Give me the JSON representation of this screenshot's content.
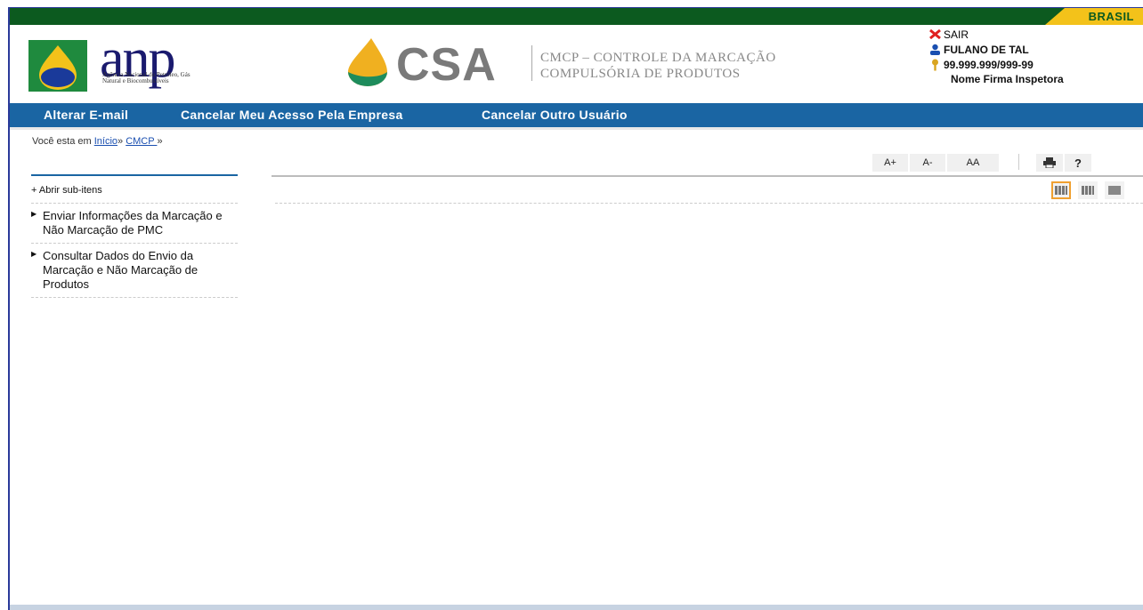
{
  "gov_bar": {
    "brasil_label": "BRASIL"
  },
  "header": {
    "anp_logo_text": "anp",
    "anp_subtitle": "Agência Nacional do Petróleo, Gás Natural e Biocombustíveis",
    "csa_logo_text": "CSA",
    "csa_desc_line1": "CMCP – CONTROLE DA MARCAÇÃO",
    "csa_desc_line2": "COMPULSÓRIA DE PRODUTOS"
  },
  "user": {
    "sair_label": "SAIR",
    "name": "FULANO DE TAL",
    "cnpj": "99.999.999/999-99",
    "firma": "Nome Firma Inspetora"
  },
  "nav": {
    "items": [
      "Alterar E-mail",
      "Cancelar Meu Acesso Pela Empresa",
      "Cancelar Outro Usuário"
    ]
  },
  "breadcrumb": {
    "prefix": "Você esta em",
    "links": [
      "Início",
      "CMCP "
    ],
    "sep": "»"
  },
  "tools": {
    "font_increase": "A+",
    "font_decrease": "A-",
    "font_default": "AA",
    "print_icon": "printer-icon",
    "help": "?"
  },
  "menu": {
    "expand_label": "+ Abrir sub-itens",
    "items": [
      "Enviar Informações da Marcação e Não Marcação de PMC",
      "Consultar Dados do Envio da Marcação e Não Marcação de Produtos"
    ]
  },
  "colors": {
    "gov_green": "#0c5a1f",
    "brasil_yellow": "#f3c21a",
    "nav_blue": "#1a65a3",
    "link_blue": "#1a4fb0",
    "active_orange": "#f0a030"
  }
}
